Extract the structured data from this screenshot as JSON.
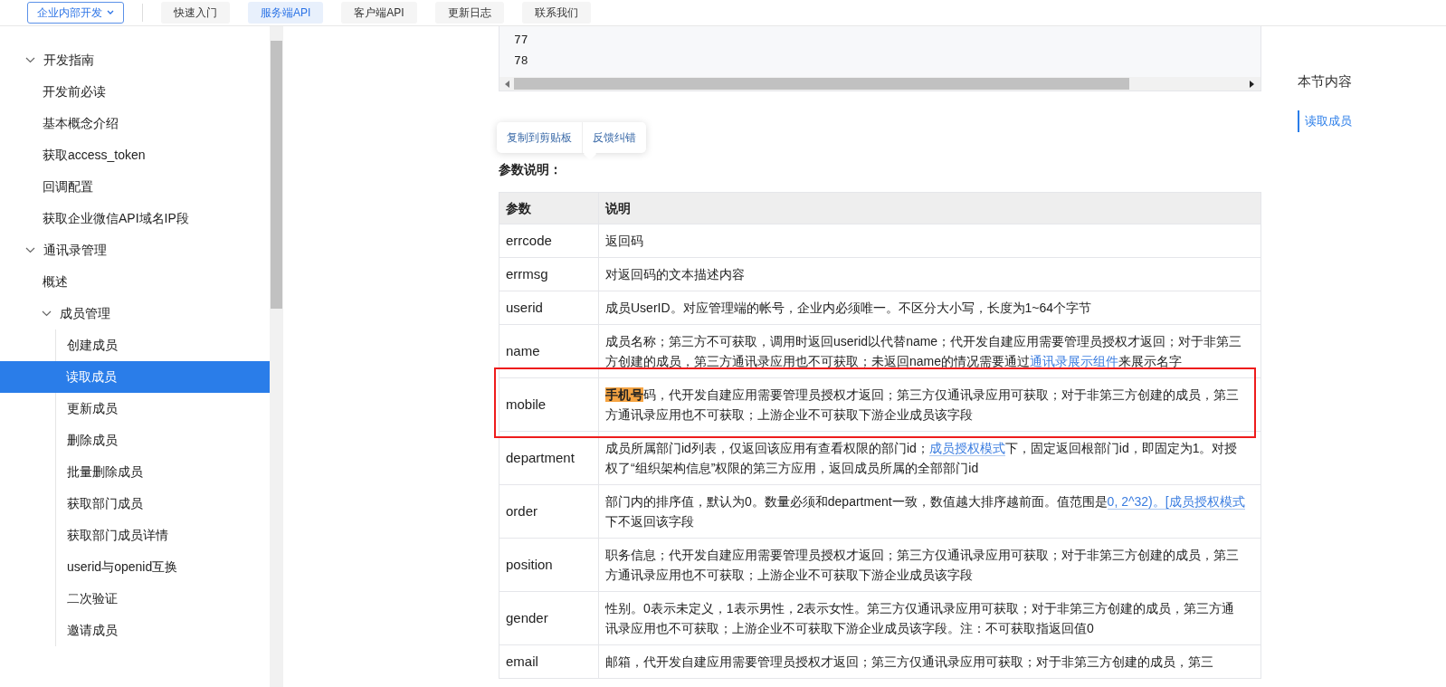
{
  "nav": {
    "dropdown": "企业内部开发",
    "tabs": [
      {
        "label": "快速入门",
        "selected": false
      },
      {
        "label": "服务端API",
        "selected": true
      },
      {
        "label": "客户端API",
        "selected": false
      },
      {
        "label": "更新日志",
        "selected": false
      },
      {
        "label": "联系我们",
        "selected": false
      }
    ]
  },
  "sidebar": [
    {
      "label": "开发指南",
      "expanded": true,
      "children": [
        {
          "label": "开发前必读",
          "selected": false
        },
        {
          "label": "基本概念介绍",
          "selected": false
        },
        {
          "label": "获取access_token",
          "selected": false
        },
        {
          "label": "回调配置",
          "selected": false
        },
        {
          "label": "获取企业微信API域名IP段",
          "selected": false
        }
      ]
    },
    {
      "label": "通讯录管理",
      "expanded": true,
      "children": [
        {
          "label": "概述",
          "selected": false
        },
        {
          "label": "成员管理",
          "expanded": true,
          "children": [
            {
              "label": "创建成员",
              "selected": false
            },
            {
              "label": "读取成员",
              "selected": true
            },
            {
              "label": "更新成员",
              "selected": false
            },
            {
              "label": "删除成员",
              "selected": false
            },
            {
              "label": "批量删除成员",
              "selected": false
            },
            {
              "label": "获取部门成员",
              "selected": false
            },
            {
              "label": "获取部门成员详情",
              "selected": false
            },
            {
              "label": "userid与openid互换",
              "selected": false
            },
            {
              "label": "二次验证",
              "selected": false
            },
            {
              "label": "邀请成员",
              "selected": false
            }
          ]
        }
      ]
    }
  ],
  "code_lines": [
    "77",
    "78"
  ],
  "popup": {
    "buttons": [
      "复制到剪贴板",
      "反馈纠错"
    ]
  },
  "section_heading": "参数说明：",
  "table": {
    "columns": [
      "参数",
      "说明"
    ],
    "rows": [
      {
        "param": "errcode",
        "boxed": false,
        "description": [
          {
            "kind": "text",
            "text": "返回码"
          }
        ]
      },
      {
        "param": "errmsg",
        "boxed": false,
        "description": [
          {
            "kind": "text",
            "text": "对返回码的文本描述内容"
          }
        ]
      },
      {
        "param": "userid",
        "boxed": false,
        "description": [
          {
            "kind": "text",
            "text": "成员UserID。对应管理端的帐号，企业内必须唯一。不区分大小写，长度为1~64个字节"
          }
        ]
      },
      {
        "param": "name",
        "boxed": false,
        "description": [
          {
            "kind": "text",
            "text": "成员名称；第三方不可获取，调用时返回userid以代替name；代开发自建应用需要管理员授权才返回；对于非第三方创建的成员，第三方通讯录应用也不可获取；未返回name的情况需要通过"
          },
          {
            "kind": "link",
            "text": "通讯录展示组件"
          },
          {
            "kind": "text",
            "text": "来展示名字"
          }
        ]
      },
      {
        "param": "mobile",
        "boxed": true,
        "description": [
          {
            "kind": "highlight",
            "text": "手机号"
          },
          {
            "kind": "text",
            "text": "码，代开发自建应用需要管理员授权才返回；第三方仅通讯录应用可获取；对于非第三方创建的成员，第三方通讯录应用也不可获取；上游企业不可获取下游企业成员该字段"
          }
        ]
      },
      {
        "param": "department",
        "boxed": false,
        "description": [
          {
            "kind": "text",
            "text": "成员所属部门id列表，仅返回该应用有查看权限的部门id；"
          },
          {
            "kind": "link",
            "text": "成员授权模式"
          },
          {
            "kind": "text",
            "text": "下，固定返回根部门id，即固定为1。对授权了“组织架构信息”权限的第三方应用，返回成员所属的全部部门id"
          }
        ]
      },
      {
        "param": "order",
        "boxed": false,
        "description": [
          {
            "kind": "text",
            "text": "部门内的排序值，默认为0。数量必须和department一致，数值越大排序越前面。值范围是"
          },
          {
            "kind": "link",
            "text": "0, 2^32)。[成员授权模式"
          },
          {
            "kind": "text",
            "text": "下不返回该字段"
          }
        ]
      },
      {
        "param": "position",
        "boxed": false,
        "description": [
          {
            "kind": "text",
            "text": "职务信息；代开发自建应用需要管理员授权才返回；第三方仅通讯录应用可获取；对于非第三方创建的成员，第三方通讯录应用也不可获取；上游企业不可获取下游企业成员该字段"
          }
        ]
      },
      {
        "param": "gender",
        "boxed": false,
        "description": [
          {
            "kind": "text",
            "text": "性别。0表示未定义，1表示男性，2表示女性。第三方仅通讯录应用可获取；对于非第三方创建的成员，第三方通讯录应用也不可获取；上游企业不可获取下游企业成员该字段。注：不可获取指返回值0"
          }
        ]
      },
      {
        "param": "email",
        "boxed": false,
        "description": [
          {
            "kind": "text",
            "text": "邮箱，代开发自建应用需要管理员授权才返回；第三方仅通讯录应用可获取；对于非第三方创建的成员，第三"
          }
        ]
      }
    ]
  },
  "toc": {
    "title": "本节内容",
    "items": [
      {
        "label": "读取成员",
        "selected": true
      }
    ]
  }
}
